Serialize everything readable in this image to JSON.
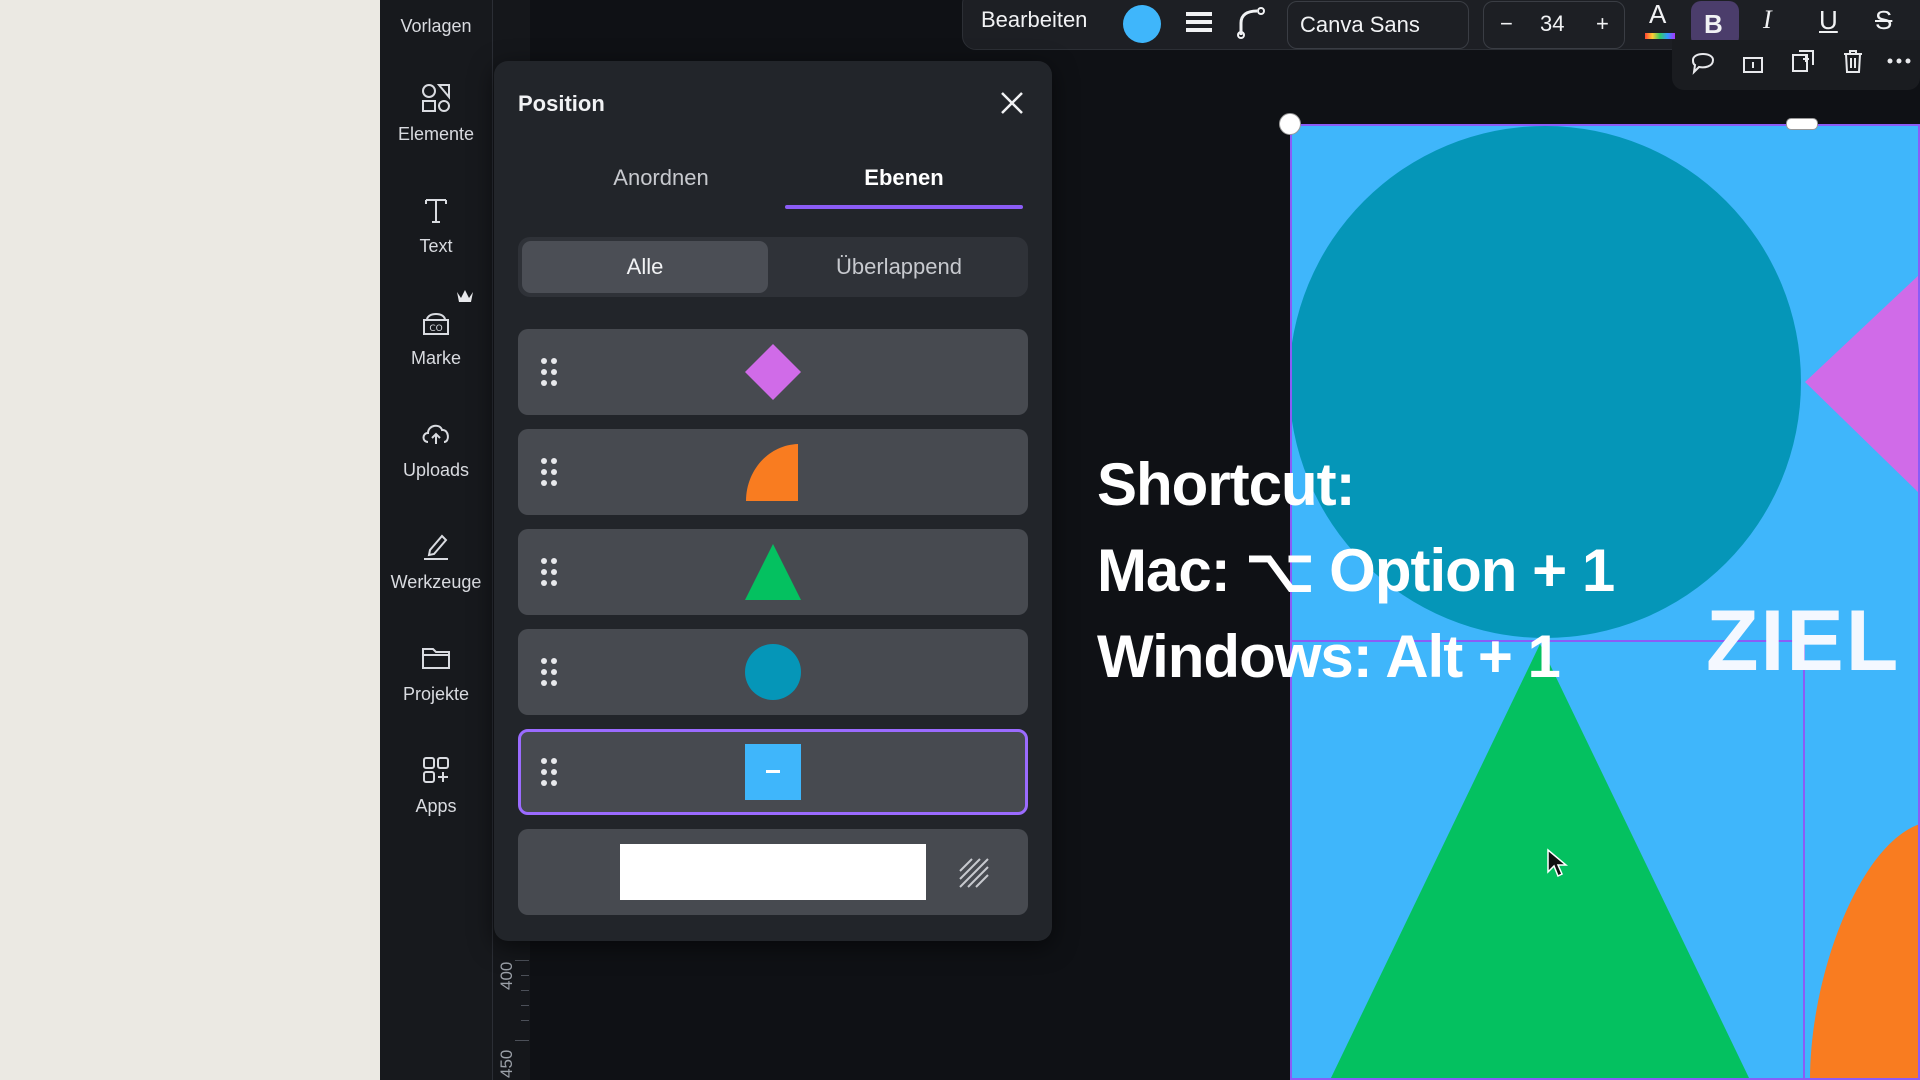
{
  "sidebar": {
    "items": [
      {
        "label": "Vorlagen",
        "icon": "template-icon"
      },
      {
        "label": "Elemente",
        "icon": "elements-icon"
      },
      {
        "label": "Text",
        "icon": "text-icon"
      },
      {
        "label": "Marke",
        "icon": "brand-icon"
      },
      {
        "label": "Uploads",
        "icon": "cloud-upload-icon"
      },
      {
        "label": "Werkzeuge",
        "icon": "pen-tool-icon"
      },
      {
        "label": "Projekte",
        "icon": "folder-icon"
      },
      {
        "label": "Apps",
        "icon": "apps-grid-icon"
      }
    ]
  },
  "ruler": {
    "labels": [
      "400",
      "450"
    ]
  },
  "toolbar": {
    "edit_label": "Bearbeiten",
    "color": "#3fb6fb",
    "font_name": "Canva Sans",
    "size_minus": "−",
    "font_size": "34",
    "size_plus": "+",
    "text_color_glyph": "A",
    "bold_glyph": "B",
    "italic_glyph": "I",
    "underline_glyph": "U",
    "strike_glyph": "S"
  },
  "panel": {
    "title": "Position",
    "tabs": [
      {
        "label": "Anordnen",
        "active": false
      },
      {
        "label": "Ebenen",
        "active": true
      }
    ],
    "segments": [
      {
        "label": "Alle",
        "active": true
      },
      {
        "label": "Überlappend",
        "active": false
      }
    ],
    "layers": [
      {
        "shape": "diamond",
        "color": "#d06be8",
        "selected": false
      },
      {
        "shape": "quarter-circle",
        "color": "#f97c20",
        "selected": false
      },
      {
        "shape": "triangle",
        "color": "#04c160",
        "selected": false
      },
      {
        "shape": "circle",
        "color": "#0596b8",
        "selected": false
      },
      {
        "shape": "square",
        "color": "#3fb6fb",
        "selected": true
      },
      {
        "shape": "background",
        "color": "#ffffff",
        "selected": false
      }
    ]
  },
  "overlay": {
    "line1": "Shortcut:",
    "line2": "Mac: ⌥ Option + 1",
    "line3": "Windows: Alt + 1"
  },
  "design": {
    "label": "ZIEL",
    "colors": {
      "background": "#3fb6fb",
      "circle": "#0596b8",
      "triangle": "#04c160",
      "diamond": "#d06be8",
      "orange": "#f97c20",
      "selection": "#8a5cf6"
    }
  }
}
